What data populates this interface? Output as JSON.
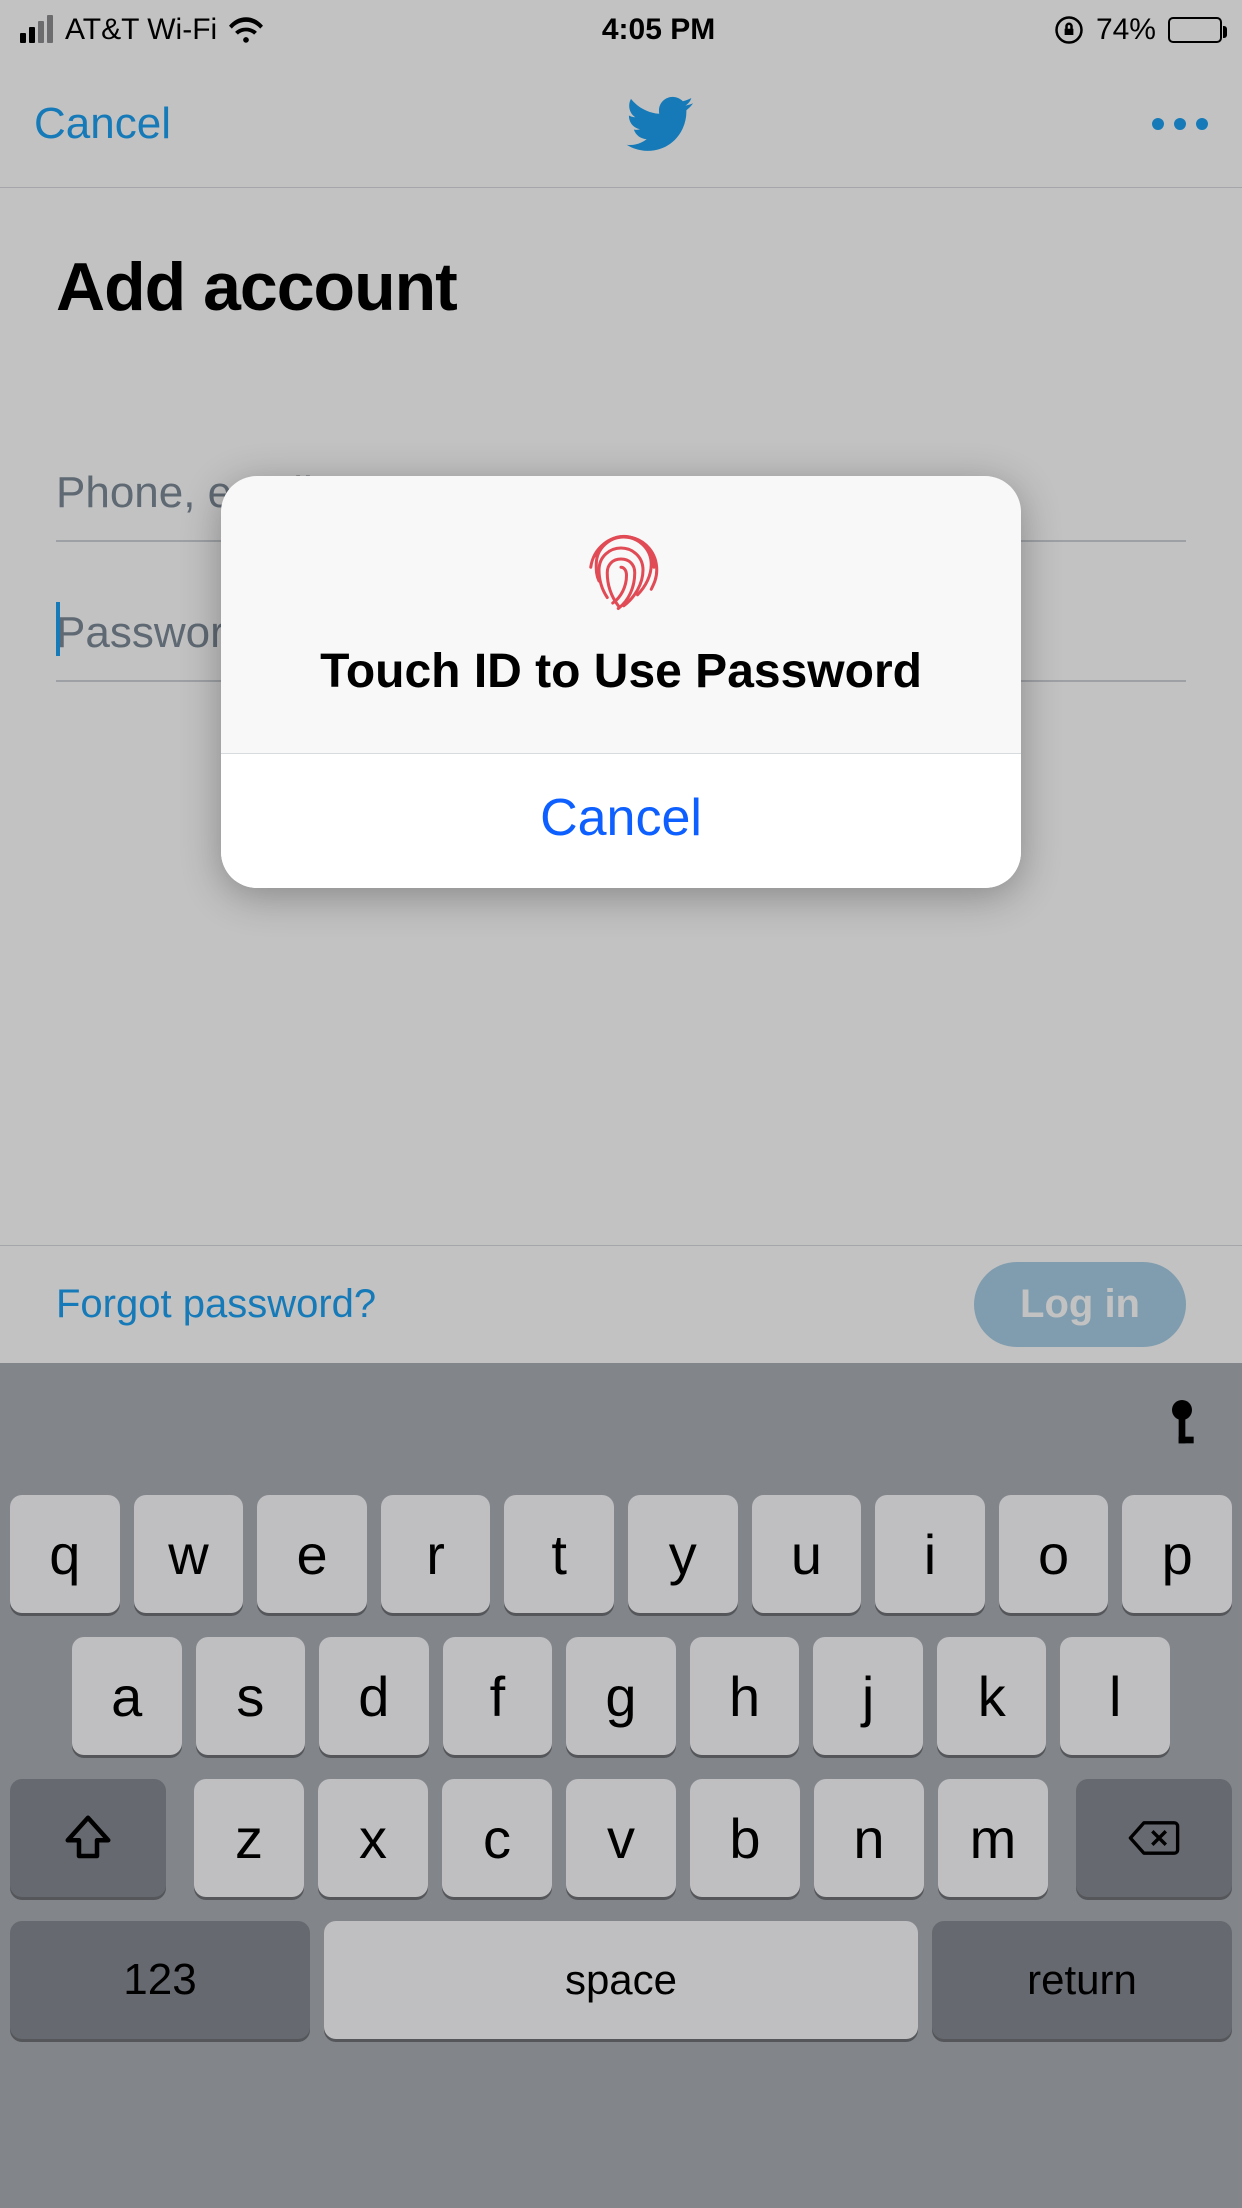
{
  "status": {
    "carrier": "AT&T Wi-Fi",
    "time": "4:05 PM",
    "battery_pct": "74%"
  },
  "nav": {
    "cancel": "Cancel"
  },
  "page": {
    "title": "Add account",
    "username_placeholder": "Phone, email or username",
    "password_placeholder": "Password"
  },
  "footer": {
    "forgot": "Forgot password?",
    "login": "Log in"
  },
  "modal": {
    "title": "Touch ID to Use Password",
    "cancel": "Cancel"
  },
  "keyboard": {
    "row1": [
      "q",
      "w",
      "e",
      "r",
      "t",
      "y",
      "u",
      "i",
      "o",
      "p"
    ],
    "row2": [
      "a",
      "s",
      "d",
      "f",
      "g",
      "h",
      "j",
      "k",
      "l"
    ],
    "row3": [
      "z",
      "x",
      "c",
      "v",
      "b",
      "n",
      "m"
    ],
    "k123": "123",
    "space": "space",
    "return": "return"
  }
}
